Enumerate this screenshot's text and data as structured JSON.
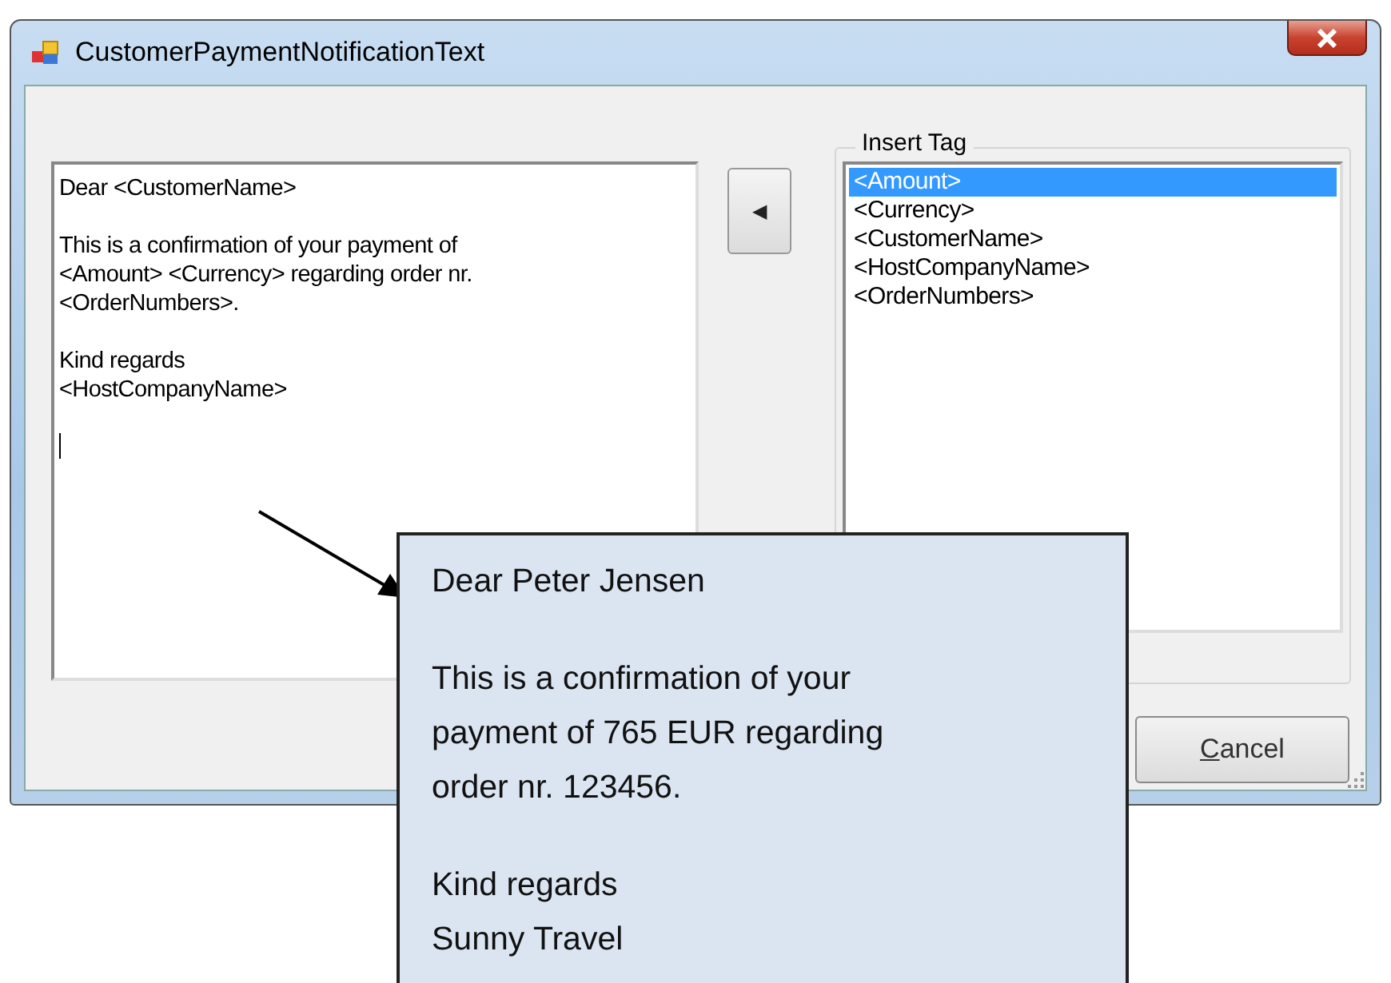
{
  "window": {
    "title": "CustomerPaymentNotificationText"
  },
  "editor": {
    "paragraphs": [
      [
        "Dear <CustomerName>"
      ],
      [
        "This is a confirmation of your payment of",
        "<Amount> <Currency> regarding order nr.",
        "<OrderNumbers>."
      ],
      [
        "Kind regards",
        "<HostCompanyName>"
      ]
    ],
    "caret": true
  },
  "insert_button": {
    "icon": "◀"
  },
  "insert_tag": {
    "label": "Insert Tag",
    "items": [
      {
        "label": "<Amount>",
        "selected": true
      },
      {
        "label": "<Currency>",
        "selected": false
      },
      {
        "label": "<CustomerName>",
        "selected": false
      },
      {
        "label": "<HostCompanyName>",
        "selected": false
      },
      {
        "label": "<OrderNumbers>",
        "selected": false
      }
    ]
  },
  "buttons": [
    {
      "label": "Cancel"
    }
  ],
  "preview_callout": {
    "paragraphs": [
      [
        "Dear Peter Jensen"
      ],
      [
        "This is a confirmation of your",
        "payment of 765 EUR regarding",
        "order nr. 123456."
      ],
      [
        "Kind regards",
        "Sunny Travel"
      ]
    ]
  }
}
